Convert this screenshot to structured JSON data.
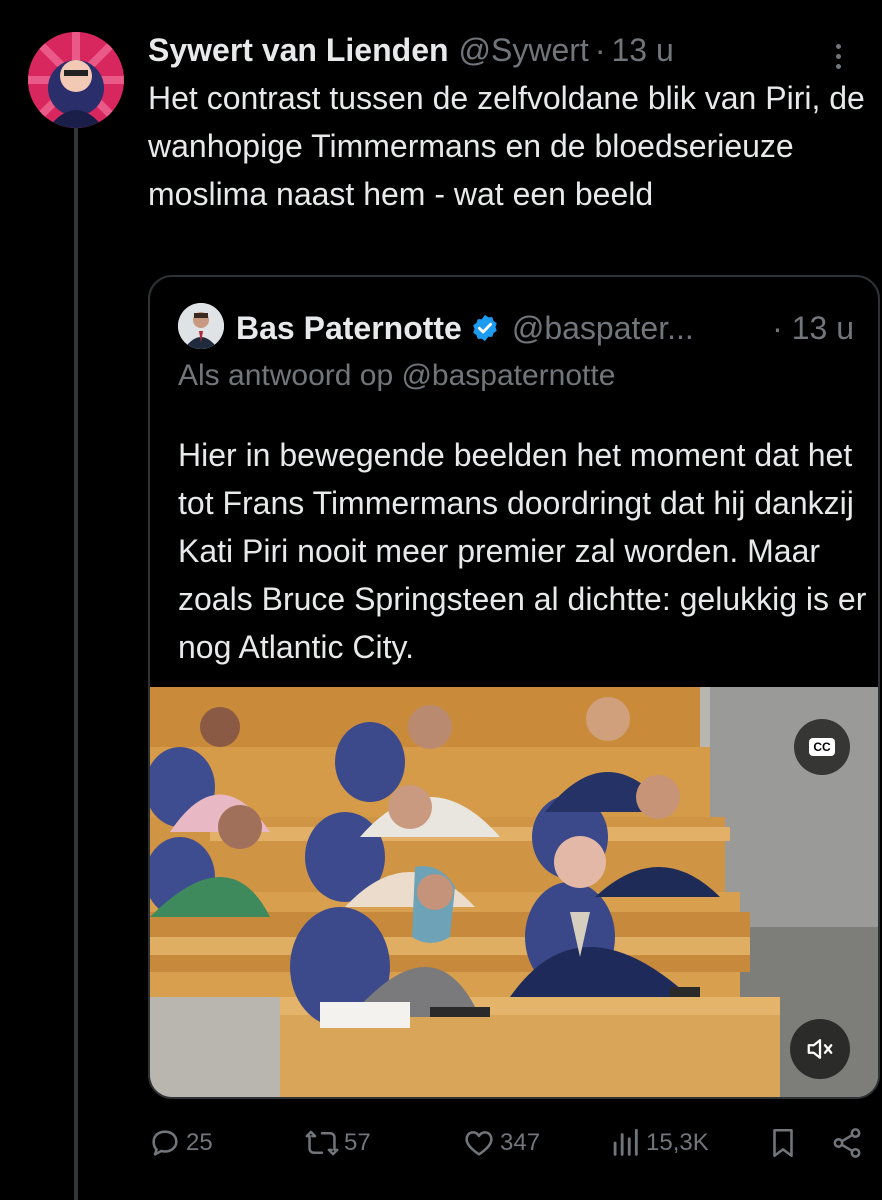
{
  "tweet": {
    "author_name": "Sywert van Lienden",
    "handle": "@Sywert",
    "separator": "·",
    "time": "13 u",
    "text": "Het contrast tussen de zelfvoldane blik van Piri, de wanhopige Timmermans en de bloedserieuze moslima naast hem - wat een beeld"
  },
  "quote": {
    "author_name": "Bas Paternotte",
    "handle": "@baspater...",
    "time": "· 13 u",
    "reply_to": "Als antwoord op @baspaternotte",
    "text": "Hier in bewegende beelden het moment dat het tot Frans Timmermans doordringt dat hij dankzij Kati Piri nooit meer premier zal worden. Maar zoals Bruce Springsteen al dichtte: gelukkig is er nog Atlantic City.",
    "video": {
      "cc_label": "CC"
    }
  },
  "actions": {
    "replies": "25",
    "reposts": "57",
    "likes": "347",
    "views": "15,3K"
  },
  "colors": {
    "background": "#000000",
    "text_primary": "#e7e9ea",
    "text_secondary": "#71767b",
    "verified_badge": "#1d9bf0",
    "border": "#2f3336"
  },
  "icons": [
    "more-icon",
    "verified-icon",
    "cc-icon",
    "mute-icon",
    "reply-icon",
    "repost-icon",
    "like-icon",
    "views-icon",
    "bookmark-icon",
    "share-icon"
  ]
}
